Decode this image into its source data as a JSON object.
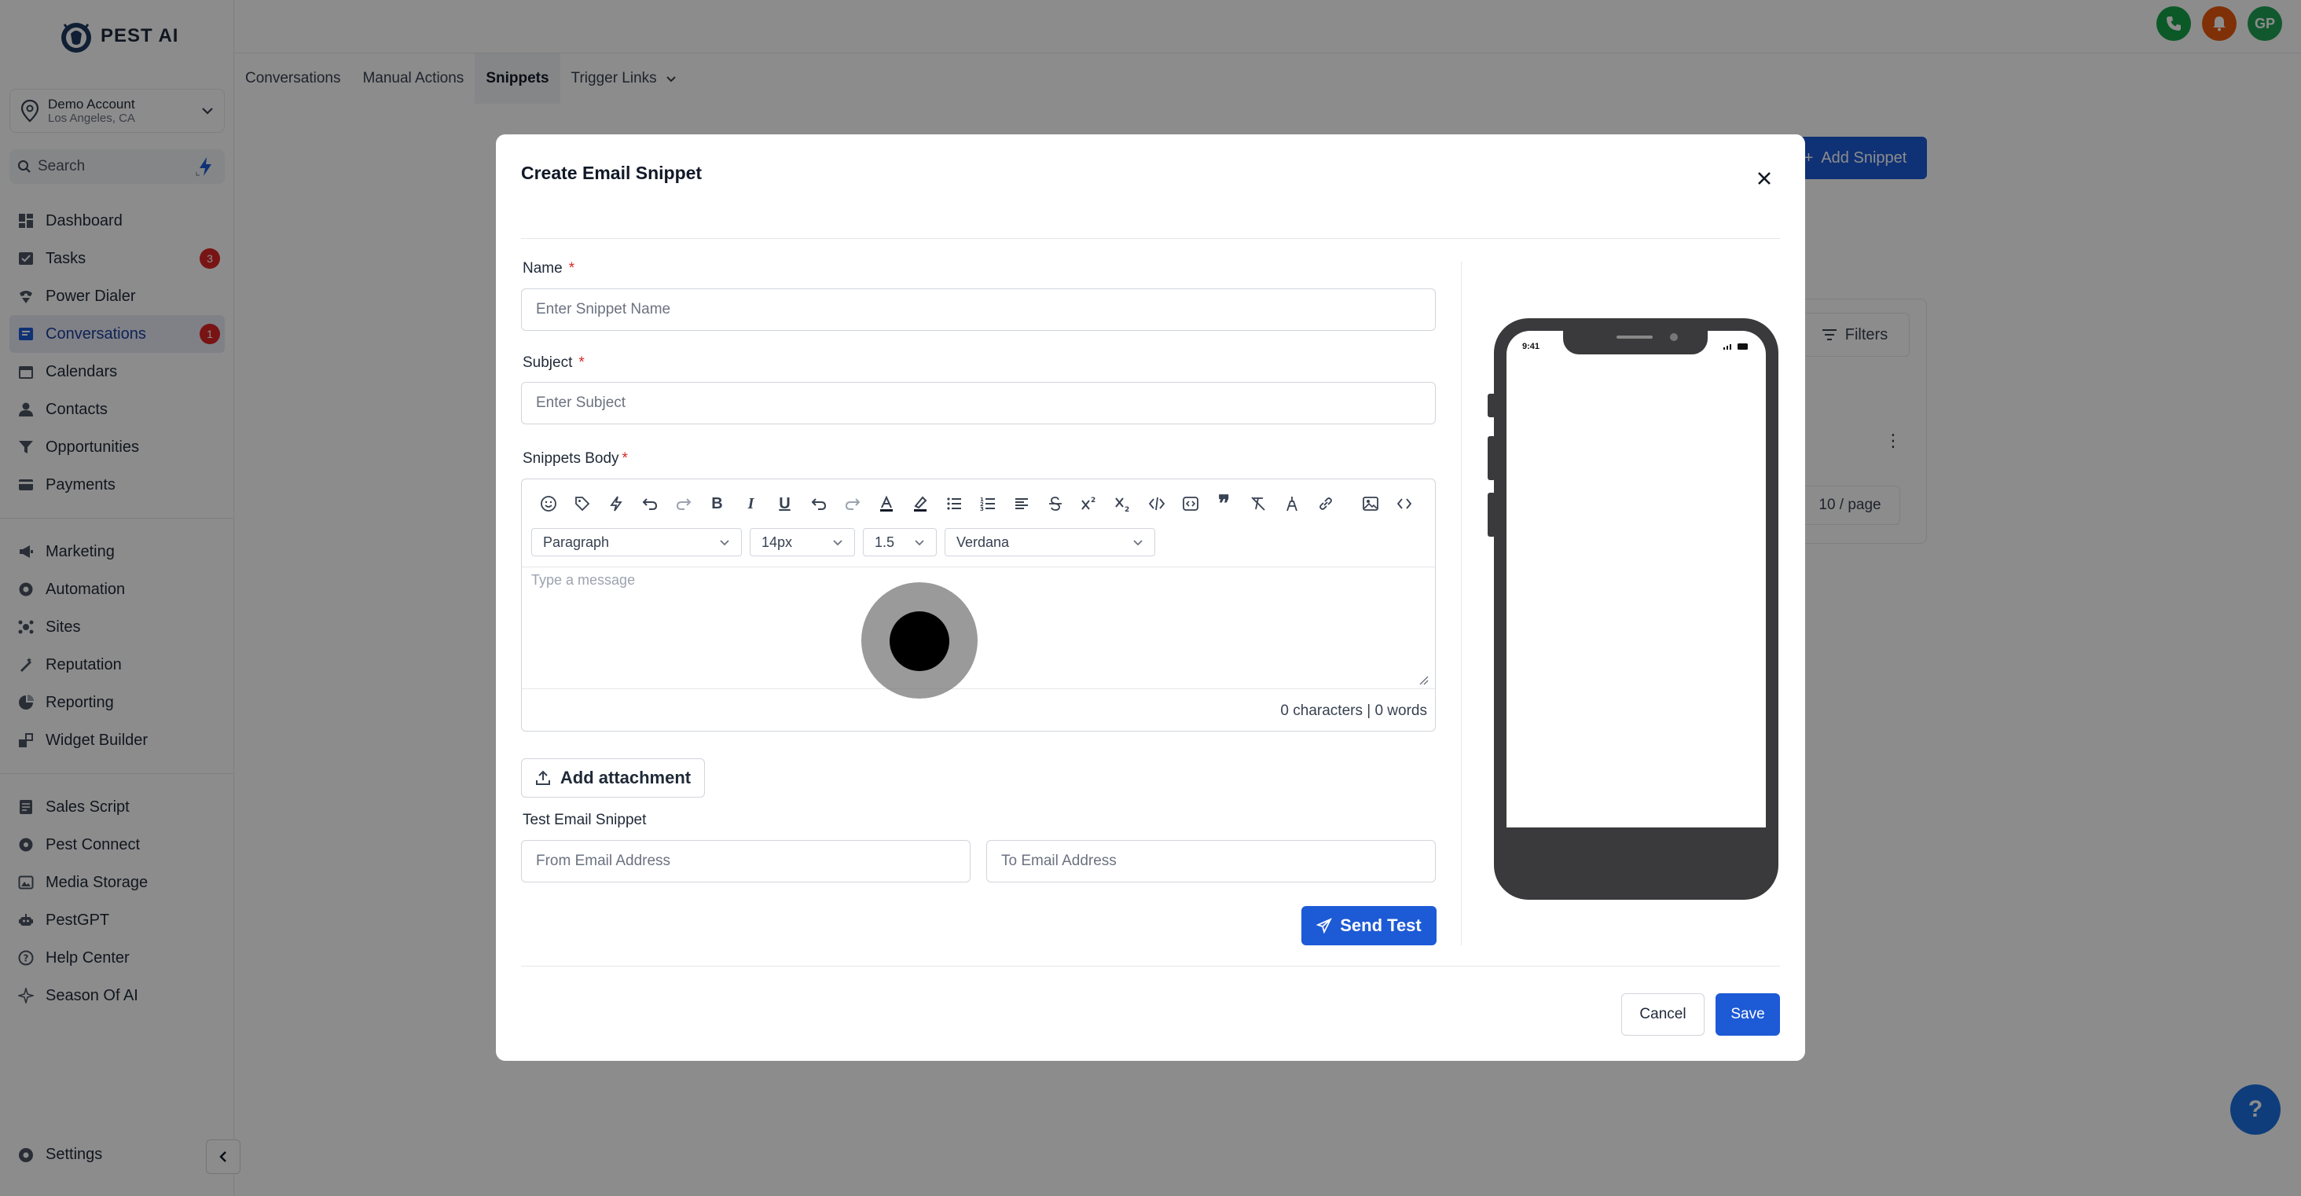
{
  "brand": {
    "name": "PEST AI"
  },
  "account": {
    "name": "Demo Account",
    "location": "Los Angeles, CA"
  },
  "search": {
    "placeholder": "Search"
  },
  "nav": {
    "group1": [
      {
        "label": "Dashboard",
        "icon": "dashboard-icon"
      },
      {
        "label": "Tasks",
        "icon": "tasks-icon",
        "badge": "3"
      },
      {
        "label": "Power Dialer",
        "icon": "power-dialer-icon"
      },
      {
        "label": "Conversations",
        "icon": "conversations-icon",
        "badge": "1",
        "active": true
      },
      {
        "label": "Calendars",
        "icon": "calendar-icon"
      },
      {
        "label": "Contacts",
        "icon": "contacts-icon"
      },
      {
        "label": "Opportunities",
        "icon": "funnel-icon"
      },
      {
        "label": "Payments",
        "icon": "payments-icon"
      }
    ],
    "group2": [
      {
        "label": "Marketing",
        "icon": "megaphone-icon"
      },
      {
        "label": "Automation",
        "icon": "automation-icon"
      },
      {
        "label": "Sites",
        "icon": "sites-icon"
      },
      {
        "label": "Reputation",
        "icon": "reputation-icon"
      },
      {
        "label": "Reporting",
        "icon": "reporting-icon"
      },
      {
        "label": "Widget Builder",
        "icon": "widget-icon"
      }
    ],
    "group3": [
      {
        "label": "Sales Script",
        "icon": "script-icon"
      },
      {
        "label": "Pest Connect",
        "icon": "connect-icon"
      },
      {
        "label": "Media Storage",
        "icon": "media-icon"
      },
      {
        "label": "PestGPT",
        "icon": "robot-icon"
      },
      {
        "label": "Help Center",
        "icon": "help-circle-icon"
      },
      {
        "label": "Season Of AI",
        "icon": "sparkle-icon"
      }
    ],
    "settings": "Settings"
  },
  "topbar": {
    "avatar_initials": "GP"
  },
  "tabs": [
    {
      "label": "Conversations"
    },
    {
      "label": "Manual Actions"
    },
    {
      "label": "Snippets",
      "active": true
    },
    {
      "label": "Trigger Links"
    }
  ],
  "background": {
    "add_snippet": "Add Snippet",
    "filters": "Filters",
    "page_size": "10 / page"
  },
  "modal": {
    "title": "Create Email Snippet",
    "name_label": "Name",
    "name_placeholder": "Enter Snippet Name",
    "subject_label": "Subject",
    "subject_placeholder": "Enter Subject",
    "body_label": "Snippets Body",
    "required_mark": "*",
    "editor": {
      "block_format": "Paragraph",
      "font_size": "14px",
      "line_height": "1.5",
      "font_family": "Verdana",
      "placeholder": "Type a message",
      "counter": "0 characters | 0 words"
    },
    "add_attachment": "Add attachment",
    "test_label": "Test Email Snippet",
    "from_placeholder": "From Email Address",
    "to_placeholder": "To Email Address",
    "send_test": "Send Test",
    "cancel": "Cancel",
    "save": "Save",
    "phone_time": "9:41"
  },
  "colors": {
    "primary": "#1d5ad6",
    "badge": "#dc2626",
    "phone": "#3a3a3c"
  }
}
